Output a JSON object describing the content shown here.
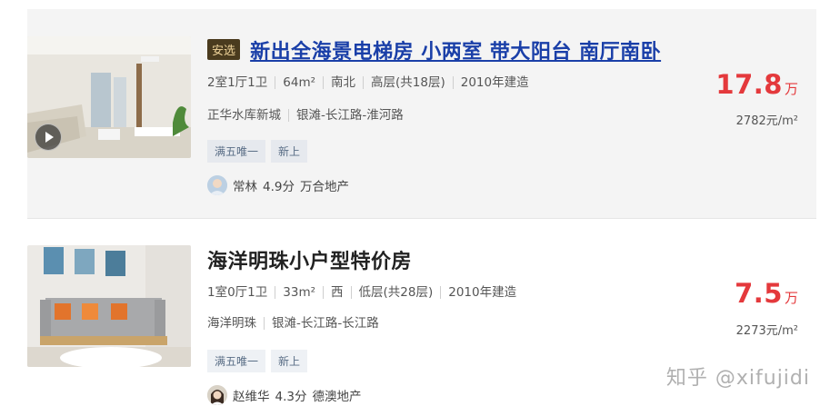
{
  "listings": [
    {
      "badge": "安选",
      "title": "新出全海景电梯房 小两室 带大阳台 南厅南卧",
      "info": [
        "2室1厅1卫",
        "64m²",
        "南北",
        "高层(共18层)",
        "2010年建造"
      ],
      "community": "正华水库新城",
      "area": "银滩-长江路-淮河路",
      "tags": [
        "满五唯一",
        "新上"
      ],
      "agent": {
        "name": "常林",
        "score": "4.9分",
        "company": "万合地产"
      },
      "price": {
        "value": "17.8",
        "unit": "万",
        "per_sqm": "2782元/m²"
      },
      "has_video": true
    },
    {
      "title": "海洋明珠小户型特价房",
      "info": [
        "1室0厅1卫",
        "33m²",
        "西",
        "低层(共28层)",
        "2010年建造"
      ],
      "community": "海洋明珠",
      "area": "银滩-长江路-长江路",
      "tags": [
        "满五唯一",
        "新上"
      ],
      "agent": {
        "name": "赵维华",
        "score": "4.3分",
        "company": "德澳地产"
      },
      "price": {
        "value": "7.5",
        "unit": "万",
        "per_sqm": "2273元/m²"
      },
      "has_video": false
    }
  ],
  "watermark": "知乎 @xifujidi",
  "colors": {
    "price": "#e4393c",
    "badge_bg": "#4a3b1e",
    "badge_text": "#f0d49a",
    "visited_link": "#1a3fa8"
  },
  "icons": [
    "play-icon",
    "avatar-icon"
  ]
}
